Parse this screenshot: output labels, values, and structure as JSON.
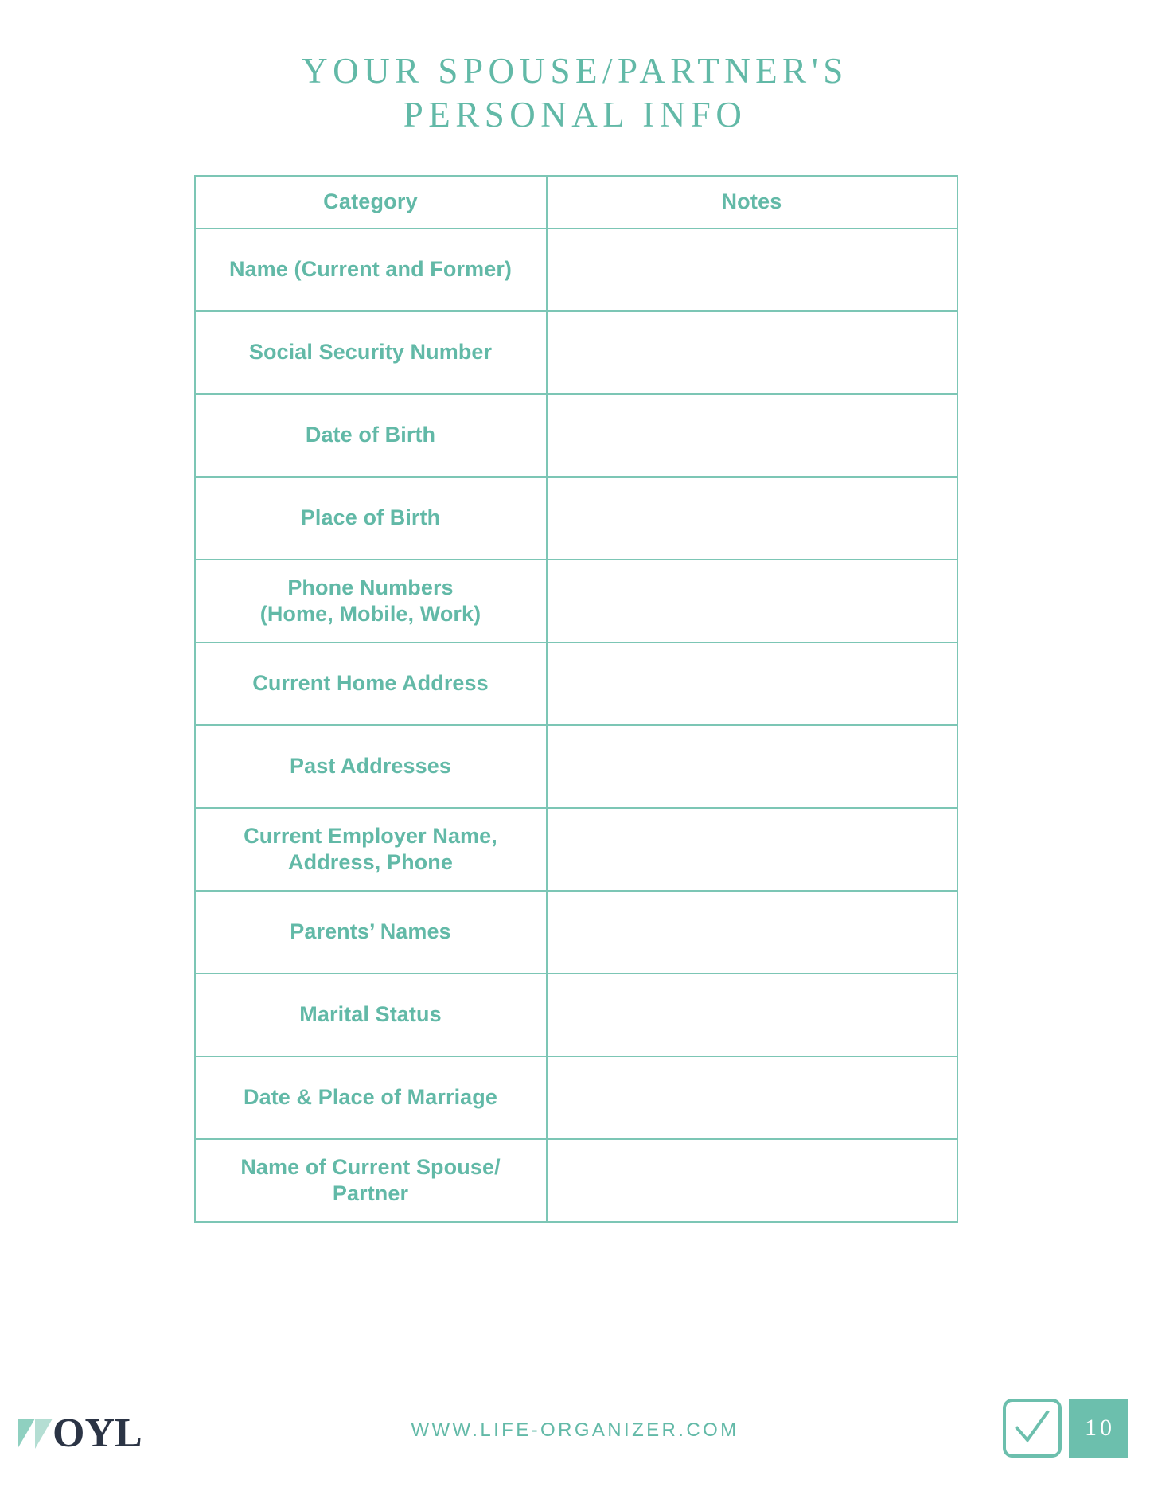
{
  "document": {
    "title": "YOUR SPOUSE/PARTNER'S\nPERSONAL INFO"
  },
  "colors": {
    "teal": "#62b9a7",
    "teal_solid": "#6cbfad",
    "border": "#7cc6b5",
    "logo_navy": "#2b3445"
  },
  "table": {
    "headers": {
      "category": "Category",
      "notes": "Notes"
    },
    "rows": [
      {
        "category": "Name (Current and Former)",
        "notes": ""
      },
      {
        "category": "Social Security Number",
        "notes": ""
      },
      {
        "category": "Date of Birth",
        "notes": ""
      },
      {
        "category": "Place of Birth",
        "notes": ""
      },
      {
        "category": "Phone Numbers\n(Home, Mobile, Work)",
        "notes": ""
      },
      {
        "category": "Current Home Address",
        "notes": ""
      },
      {
        "category": "Past Addresses",
        "notes": ""
      },
      {
        "category": "Current Employer Name,\nAddress, Phone",
        "notes": ""
      },
      {
        "category": "Parents’ Names",
        "notes": ""
      },
      {
        "category": "Marital Status",
        "notes": ""
      },
      {
        "category": "Date & Place of Marriage",
        "notes": ""
      },
      {
        "category": "Name of Current Spouse/\nPartner",
        "notes": ""
      }
    ]
  },
  "footer": {
    "logo_text": "OYL",
    "logo_mark_icon": "oyl-chevron-mark-icon",
    "website": "WWW.LIFE-ORGANIZER.COM",
    "checkbox_icon": "checkmark-icon",
    "page_number": "10"
  }
}
